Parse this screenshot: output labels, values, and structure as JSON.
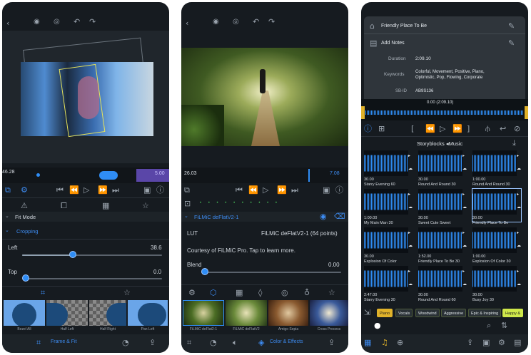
{
  "phone1": {
    "time_start": "46.28",
    "time_end": "5.00",
    "section_fit_mode": "Fit Mode",
    "section_cropping": "Cropping",
    "left_label": "Left",
    "left_value": "38.6",
    "top_label": "Top",
    "top_value": "0.0",
    "thumb_labels": [
      "Bezel All",
      "Half Left",
      "Half Right",
      "Pan Left"
    ],
    "bottom_label": "Frame & Fit"
  },
  "phone2": {
    "time_start": "26.03",
    "time_end": "7.08",
    "filter_name": "FiLMiC deFlatV2-1",
    "lut_label": "LUT",
    "lut_value": "FiLMiC deFlatV2-1 (64 points)",
    "courtesy_text": "Courtesy of FiLMiC Pro. Tap to learn more.",
    "blend_label": "Blend",
    "blend_value": "0.00",
    "thumb_labels": [
      "FiLMiC deFlat2-1",
      "FiLMiC deFlatV2",
      "Amigo Sepia",
      "Cross Process"
    ],
    "bottom_label": "Color & Effects"
  },
  "phone3": {
    "title": "Friendly Place To Be",
    "add_notes": "Add Notes",
    "duration_label": "Duration",
    "duration_value": "2:09.10",
    "keywords_label": "Keywords",
    "keywords_value": "Colorful, Movement, Positive, Piano, Optimistic, Pop, Flowing, Corporate",
    "sbid_label": "SB-ID",
    "sbid_value": "AB9S136",
    "waveform_time": "0.00 (2:09.10)",
    "browser_title": "Storyblocks ◂Music",
    "tiles": [
      {
        "duration": "30.00",
        "title": "Starry Evening 60"
      },
      {
        "duration": "30.00",
        "title": "Round And Round 30"
      },
      {
        "duration": "1:00.00",
        "title": "Round And Round 30"
      },
      {
        "duration": "1:00.00",
        "title": "My Main Man 30"
      },
      {
        "duration": "30.00",
        "title": "Sweet Cute Sweet"
      },
      {
        "duration": "30.00",
        "title": "Friendly Place To Be"
      },
      {
        "duration": "30.00",
        "title": "Explosion Of Color"
      },
      {
        "duration": "1:52.00",
        "title": "Friendly Place To Be 30"
      },
      {
        "duration": "1:00.00",
        "title": "Explosion Of Color 30"
      },
      {
        "duration": "2:47.00",
        "title": "Starry Evening 30"
      },
      {
        "duration": "30.00",
        "title": "Round And Round 60"
      },
      {
        "duration": "30.00",
        "title": "Busy Joy 30"
      }
    ],
    "tags": [
      "Piano",
      "Vocals",
      "Woodwind",
      "Aggressive",
      "Epic & Inspiring",
      "Happy &"
    ],
    "accent_color": "#2f8df5",
    "wave_color": "#2f8df5"
  }
}
